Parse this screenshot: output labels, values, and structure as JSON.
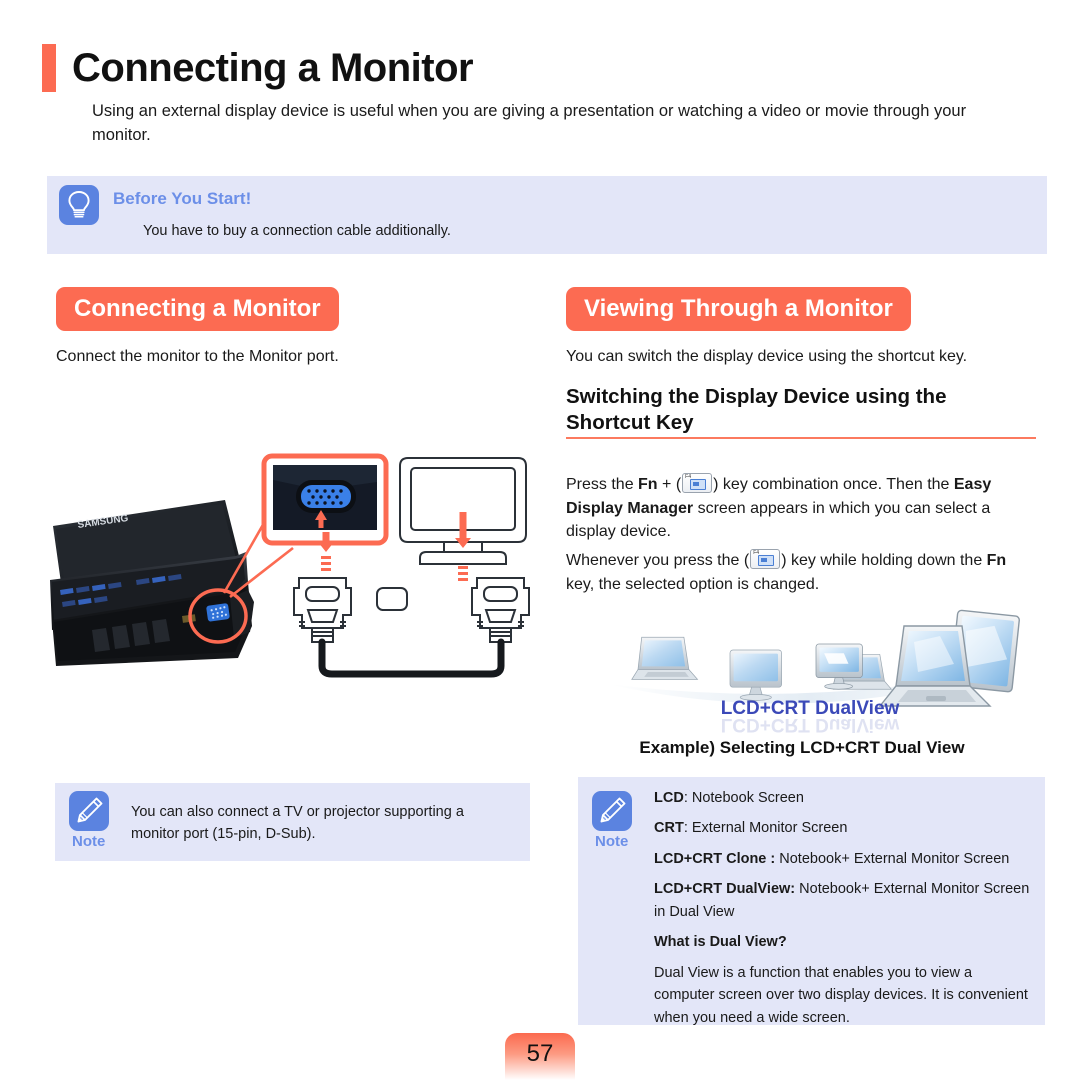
{
  "page": {
    "title": "Connecting a Monitor",
    "intro": "Using an external display device is useful when you are giving a presentation or watching a video or movie through your monitor.",
    "number": "57"
  },
  "before_you_start": {
    "icon": "lightbulb-icon",
    "heading": "Before You Start!",
    "text": "You have to buy a connection cable additionally."
  },
  "left_column": {
    "header": "Connecting a Monitor",
    "lead": "Connect the monitor to the Monitor port.",
    "illustration": {
      "laptop_brand": "SAMSUNG",
      "callout": "vga-port-closeup",
      "monitor": "crt-monitor-outline",
      "cable": "vga-cable-with-two-connectors"
    },
    "note": {
      "icon": "pencil-icon",
      "label": "Note",
      "text": "You can also connect a TV or projector supporting a monitor port (15-pin, D-Sub)."
    }
  },
  "right_column": {
    "header": "Viewing Through a Monitor",
    "lead": "You can switch the display device using the shortcut key.",
    "subheading": "Switching the Display Device using the Shortcut Key",
    "paragraph1": {
      "part1": "Press the ",
      "bold1": "Fn",
      "part2": " + (",
      "key": "F4",
      "part3": ") key combination once. Then the ",
      "bold2": "Easy Display Manager",
      "part4": " screen appears in which you can select a display device."
    },
    "paragraph2": {
      "part1": "Whenever you press the (",
      "key": "F4",
      "part2": ") key while holding down the ",
      "bold1": "Fn",
      "part3": " key, the selected option is changed."
    },
    "dualview_graphic": {
      "label": "LCD+CRT DualView",
      "items": [
        "laptop",
        "monitor",
        "dual-monitor",
        "laptop-plus-monitor"
      ]
    },
    "example_caption": "Example) Selecting LCD+CRT Dual View",
    "note": {
      "icon": "pencil-icon",
      "label": "Note",
      "lines": [
        {
          "term": "LCD",
          "sep": ": ",
          "desc": "Notebook Screen"
        },
        {
          "term": "CRT",
          "sep": ": ",
          "desc": "External Monitor Screen"
        },
        {
          "term": "LCD+CRT Clone :",
          "sep": " ",
          "desc": "Notebook+ External Monitor Screen"
        },
        {
          "term": "LCD+CRT DualView:",
          "sep": " ",
          "desc": "Notebook+ External Monitor Screen in Dual View"
        }
      ],
      "question": "What is Dual View?",
      "answer": "Dual View is a function that enables you to view a computer screen over two display devices. It is convenient when you need a wide screen."
    }
  },
  "colors": {
    "accent": "#fc6b52",
    "note_bg": "#e3e6f8",
    "note_icon": "#5b83e0",
    "note_label": "#6c8fe8",
    "dualview_text": "#3b49b8"
  }
}
